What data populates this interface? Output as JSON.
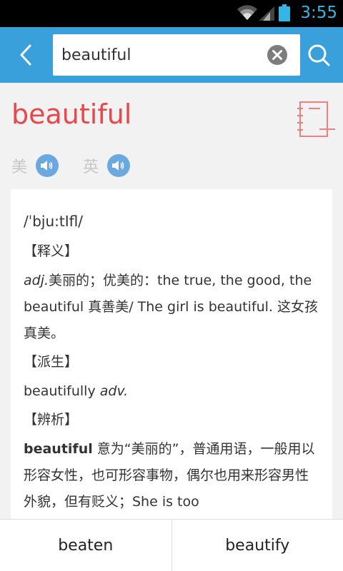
{
  "status": {
    "time": "3:55"
  },
  "header": {
    "search_value": "beautiful",
    "back_icon": "chevron-left-icon",
    "clear_icon": "close-circle-icon",
    "search_icon": "search-icon",
    "bar_color": "#3aa0dc"
  },
  "word": {
    "title": "beautiful",
    "title_color": "#e8474b",
    "notebook_icon": "add-to-notebook-icon",
    "pron_us_label": "美",
    "pron_uk_label": "英"
  },
  "entry": {
    "phonetic": "/ˈbju:tIfl/",
    "section_definition": "【释义】",
    "pos": "adj.",
    "definition_line": "美丽的；优美的：the true, the good, the beautiful 真善美/ The girl is beautiful. 这女孩真美。",
    "section_derivative": "【派生】",
    "derivative_word": "beautifully",
    "derivative_pos": "adv.",
    "section_analysis": "【辨析】",
    "analysis_word": "beautiful",
    "analysis_text": " 意为“美丽的”，普通用语，一般用以形容女性，也可形容事物，偶尔也用来形容男性外貌，但有贬义；She is too"
  },
  "bottom_nav": {
    "prev_word": "beaten",
    "next_word": "beautify"
  }
}
